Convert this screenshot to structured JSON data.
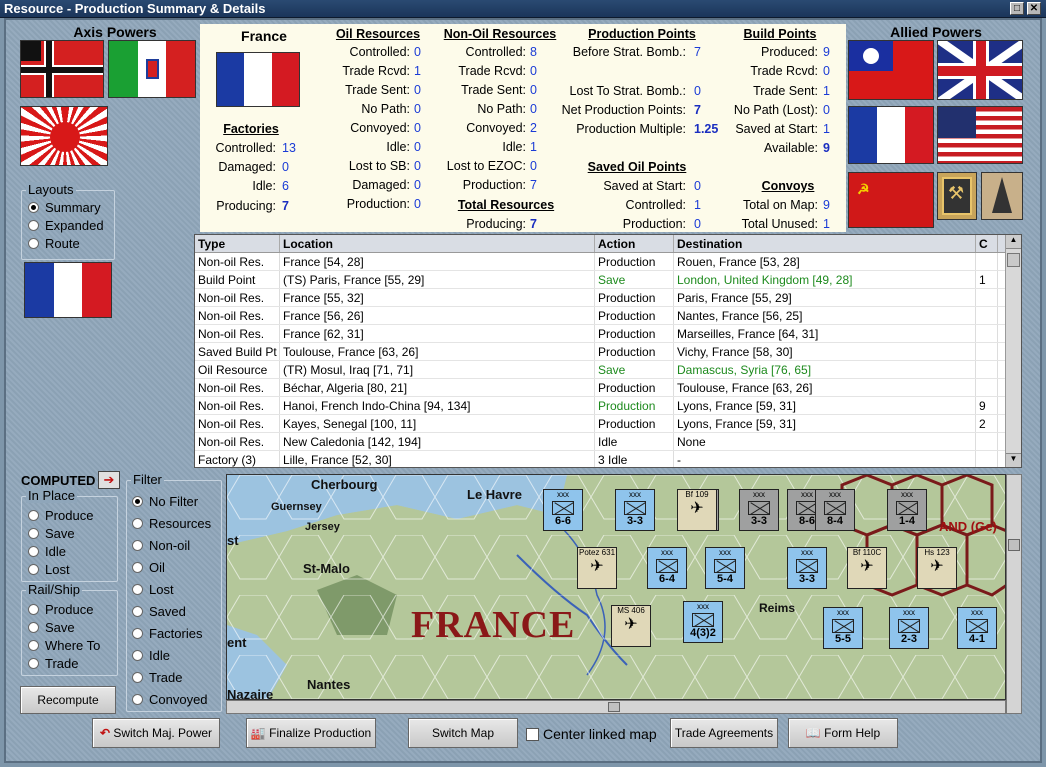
{
  "window": {
    "title": "Resource - Production Summary & Details"
  },
  "axis": {
    "title": "Axis Powers"
  },
  "allied": {
    "title": "Allied Powers"
  },
  "layouts": {
    "title": "Layouts",
    "options": [
      "Summary",
      "Expanded",
      "Route"
    ],
    "selected": "Summary"
  },
  "summary": {
    "country": "France",
    "factories": {
      "header": "Factories",
      "rows": [
        {
          "label": "Controlled:",
          "value": "13"
        },
        {
          "label": "Damaged:",
          "value": "0"
        },
        {
          "label": "Idle:",
          "value": "6"
        },
        {
          "label": "Producing:",
          "value": "7"
        }
      ]
    },
    "oil": {
      "header": "Oil Resources",
      "rows": [
        {
          "label": "Controlled:",
          "value": "0"
        },
        {
          "label": "Trade Rcvd:",
          "value": "1"
        },
        {
          "label": "Trade Sent:",
          "value": "0"
        },
        {
          "label": "No Path:",
          "value": "0"
        },
        {
          "label": "Convoyed:",
          "value": "0"
        },
        {
          "label": "Idle:",
          "value": "0"
        },
        {
          "label": "Lost to SB:",
          "value": "0"
        },
        {
          "label": "Damaged:",
          "value": "0"
        },
        {
          "label": "Production:",
          "value": "0"
        }
      ]
    },
    "nonoil": {
      "header": "Non-Oil Resources",
      "rows": [
        {
          "label": "Controlled:",
          "value": "8"
        },
        {
          "label": "Trade Rcvd:",
          "value": "0"
        },
        {
          "label": "Trade Sent:",
          "value": "0"
        },
        {
          "label": "No Path:",
          "value": "0"
        },
        {
          "label": "Convoyed:",
          "value": "2"
        },
        {
          "label": "Idle:",
          "value": "1"
        },
        {
          "label": "Lost to EZOC:",
          "value": "0"
        },
        {
          "label": "Production:",
          "value": "7"
        }
      ]
    },
    "total": {
      "header": "Total Resources",
      "rows": [
        {
          "label": "Producing:",
          "value": "7"
        }
      ]
    },
    "pp": {
      "header": "Production Points",
      "rows": [
        {
          "label": "Before Strat. Bomb.:",
          "value": "7"
        },
        {
          "label": "Lost To Strat. Bomb.:",
          "value": "0"
        },
        {
          "label": "Net Production Points:",
          "value": "7"
        },
        {
          "label": "Production Multiple:",
          "value": "1.25"
        }
      ]
    },
    "savedoil": {
      "header": "Saved Oil Points",
      "rows": [
        {
          "label": "Saved at Start:",
          "value": "0"
        },
        {
          "label": "Controlled:",
          "value": "1"
        },
        {
          "label": "Production:",
          "value": "0"
        }
      ]
    },
    "bp": {
      "header": "Build Points",
      "rows": [
        {
          "label": "Produced:",
          "value": "9"
        },
        {
          "label": "Trade Rcvd:",
          "value": "0"
        },
        {
          "label": "Trade Sent:",
          "value": "1"
        },
        {
          "label": "No Path (Lost):",
          "value": "0"
        },
        {
          "label": "Saved at Start:",
          "value": "1"
        },
        {
          "label": "Available:",
          "value": "9"
        }
      ]
    },
    "convoys": {
      "header": "Convoys",
      "rows": [
        {
          "label": "Total on Map:",
          "value": "9"
        },
        {
          "label": "Total Unused:",
          "value": "1"
        }
      ]
    }
  },
  "table": {
    "columns": [
      "Type",
      "Location",
      "Action",
      "Destination",
      "C"
    ],
    "rows": [
      {
        "type": "Non-oil Res.",
        "location": "France [54, 28]",
        "action": "Production",
        "destination": "Rouen, France [53, 28]",
        "c": "",
        "green": false
      },
      {
        "type": "Build Point",
        "location": "(TS) Paris, France [55, 29]",
        "action": "Save",
        "destination": "London, United Kingdom [49, 28]",
        "c": "1",
        "green": true
      },
      {
        "type": "Non-oil Res.",
        "location": "France [55, 32]",
        "action": "Production",
        "destination": "Paris, France [55, 29]",
        "c": "",
        "green": false
      },
      {
        "type": "Non-oil Res.",
        "location": "France [56, 26]",
        "action": "Production",
        "destination": "Nantes, France [56, 25]",
        "c": "",
        "green": false
      },
      {
        "type": "Non-oil Res.",
        "location": "France [62, 31]",
        "action": "Production",
        "destination": "Marseilles, France [64, 31]",
        "c": "",
        "green": false
      },
      {
        "type": "Saved Build Pt",
        "location": "Toulouse, France [63, 26]",
        "action": "Production",
        "destination": "Vichy, France [58, 30]",
        "c": "",
        "green": false
      },
      {
        "type": "Oil Resource",
        "location": "(TR) Mosul, Iraq [71, 71]",
        "action": "Save",
        "destination": "Damascus, Syria [76, 65]",
        "c": "",
        "green": true
      },
      {
        "type": "Non-oil Res.",
        "location": "Béchar, Algeria [80, 21]",
        "action": "Production",
        "destination": "Toulouse, France [63, 26]",
        "c": "",
        "green": false
      },
      {
        "type": "Non-oil Res.",
        "location": "Hanoi, French Indo-China [94, 134]",
        "action": "Production",
        "destination": "Lyons, France [59, 31]",
        "c": "9",
        "green": "action"
      },
      {
        "type": "Non-oil Res.",
        "location": "Kayes, Senegal [100, 11]",
        "action": "Production",
        "destination": "Lyons, France [59, 31]",
        "c": "2",
        "green": false
      },
      {
        "type": "Non-oil Res.",
        "location": "New Caledonia [142, 194]",
        "action": "Idle",
        "destination": "None",
        "c": "",
        "green": false
      },
      {
        "type": "Factory (3)",
        "location": "Lille, France [52, 30]",
        "action": "3 Idle",
        "destination": "-",
        "c": "",
        "green": false
      }
    ]
  },
  "computed": {
    "label": "COMPUTED"
  },
  "inplace": {
    "title": "In Place",
    "options": [
      "Produce",
      "Save",
      "Idle",
      "Lost"
    ]
  },
  "railship": {
    "title": "Rail/Ship",
    "options": [
      "Produce",
      "Save",
      "Where To",
      "Trade"
    ]
  },
  "filter": {
    "title": "Filter",
    "options": [
      "No Filter",
      "Resources",
      "Non-oil",
      "Oil",
      "Lost",
      "Saved",
      "Factories",
      "Idle",
      "Trade",
      "Convoyed"
    ],
    "selected": "No Filter"
  },
  "recompute": {
    "label": "Recompute"
  },
  "map": {
    "country_label": "FRANCE",
    "cities": [
      "Cherbourg",
      "Le Havre",
      "Guernsey",
      "Jersey",
      "St-Malo",
      "Nantes",
      "Reims",
      "Nazaire",
      "ent",
      "st"
    ],
    "corner_text": "AND (Ge)",
    "units": [
      {
        "label": "6-6",
        "nation": "fr"
      },
      {
        "label": "3-3",
        "nation": "fr"
      },
      {
        "label": "3",
        "nation": "de"
      },
      {
        "label": "3-3",
        "nation": "de"
      },
      {
        "label": "8-6",
        "nation": "de"
      },
      {
        "label": "8-4",
        "nation": "de"
      },
      {
        "label": "1-4",
        "nation": "de"
      },
      {
        "label": "6-4",
        "nation": "fr"
      },
      {
        "label": "5-4",
        "nation": "fr"
      },
      {
        "label": "3-3",
        "nation": "fr"
      },
      {
        "label": "5-5",
        "nation": "fr"
      },
      {
        "label": "2-3",
        "nation": "fr"
      },
      {
        "label": "4-1",
        "nation": "fr"
      },
      {
        "label": "4(3)2",
        "nation": "fr"
      }
    ],
    "aircraft": [
      "Potez 631",
      "Bf 109",
      "Bf 110C",
      "Hs 123",
      "MS 406"
    ]
  },
  "buttons": {
    "switch_power": "Switch Maj. Power",
    "finalize": "Finalize Production",
    "switch_map": "Switch Map",
    "center_linked": "Center linked map",
    "trade": "Trade Agreements",
    "form_help": "Form Help"
  }
}
